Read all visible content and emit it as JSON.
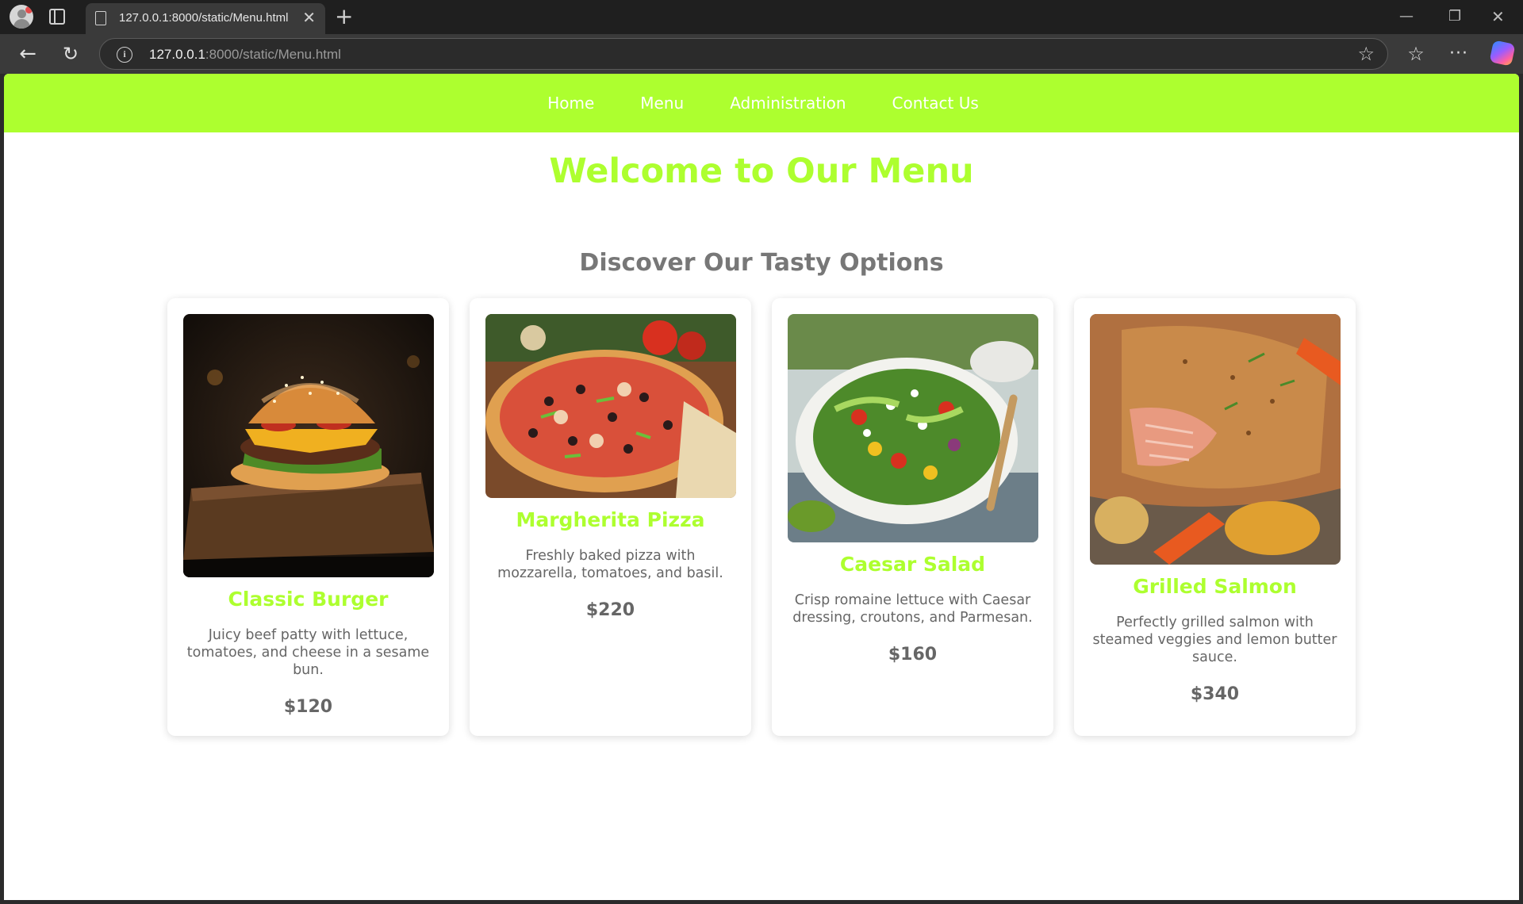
{
  "browser": {
    "tab_title": "127.0.0.1:8000/static/Menu.html",
    "url_host": "127.0.0.1",
    "url_rest": ":8000/static/Menu.html"
  },
  "site": {
    "nav": [
      {
        "label": "Home"
      },
      {
        "label": "Menu"
      },
      {
        "label": "Administration"
      },
      {
        "label": "Contact Us"
      }
    ],
    "title": "Welcome to Our Menu",
    "subtitle": "Discover Our Tasty Options",
    "colors": {
      "accent": "#adff2f",
      "text": "#666666",
      "heading_gray": "#777777"
    }
  },
  "menu_items": [
    {
      "name": "Classic Burger",
      "description": "Juicy beef patty with lettuce, tomatoes, and cheese in a sesame bun.",
      "price": "$120",
      "image": "burger-photo"
    },
    {
      "name": "Margherita Pizza",
      "description": "Freshly baked pizza with mozzarella, tomatoes, and basil.",
      "price": "$220",
      "image": "pizza-photo"
    },
    {
      "name": "Caesar Salad",
      "description": "Crisp romaine lettuce with Caesar dressing, croutons, and Parmesan.",
      "price": "$160",
      "image": "salad-photo"
    },
    {
      "name": "Grilled Salmon",
      "description": "Perfectly grilled salmon with steamed veggies and lemon butter sauce.",
      "price": "$340",
      "image": "salmon-photo"
    }
  ]
}
